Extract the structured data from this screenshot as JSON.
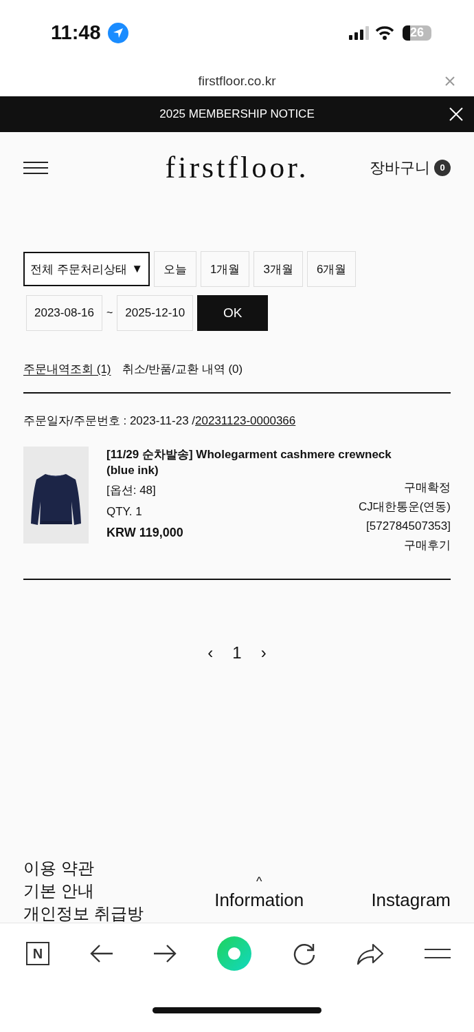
{
  "status_bar": {
    "time": "11:48",
    "battery": "26"
  },
  "browser": {
    "url": "firstfloor.co.kr"
  },
  "notice_bar": {
    "text": "2025 MEMBERSHIP NOTICE"
  },
  "header": {
    "logo": "firstfloor.",
    "cart_label": "장바구니",
    "cart_count": "0"
  },
  "filters": {
    "status_select": "전체 주문처리상태",
    "status_caret": "▼",
    "periods": [
      {
        "label": "오늘",
        "selected": false
      },
      {
        "label": "1개월",
        "selected": false
      },
      {
        "label": "3개월",
        "selected": false
      },
      {
        "label": "6개월",
        "selected": false
      }
    ],
    "date_from": "2023-08-16",
    "separator": "~",
    "date_to": "2025-12-10",
    "ok_button": "OK"
  },
  "tabs": [
    {
      "label": "주문내역조회 (1)",
      "selected": true
    },
    {
      "label": "취소/반품/교환 내역 (0)",
      "selected": false
    }
  ],
  "orders": [
    {
      "date_label": "주문일자/주문번호 : 2023-11-23 /",
      "order_number": "20231123-0000366",
      "product": {
        "kind": "picture",
        "title": "[11/29 순차발송] Wholegarment cashmere crewneck (blue ink)",
        "option": "[옵션: 48]",
        "qty": "QTY. 1",
        "price": "KRW 119,000"
      },
      "status": "구매확정",
      "courier": "CJ대한통운(연동)",
      "tracking": "[572784507353]",
      "review": "구매후기"
    }
  ],
  "pagination": {
    "prev": "‹",
    "pages": [
      "1"
    ],
    "next": "›"
  },
  "footer": {
    "links": [
      "이용 약관",
      "기본 안내",
      "개인정보 취급방"
    ],
    "caret": "^",
    "center": "Information",
    "right": "Instagram"
  },
  "toolbar": {
    "naver": "N"
  }
}
